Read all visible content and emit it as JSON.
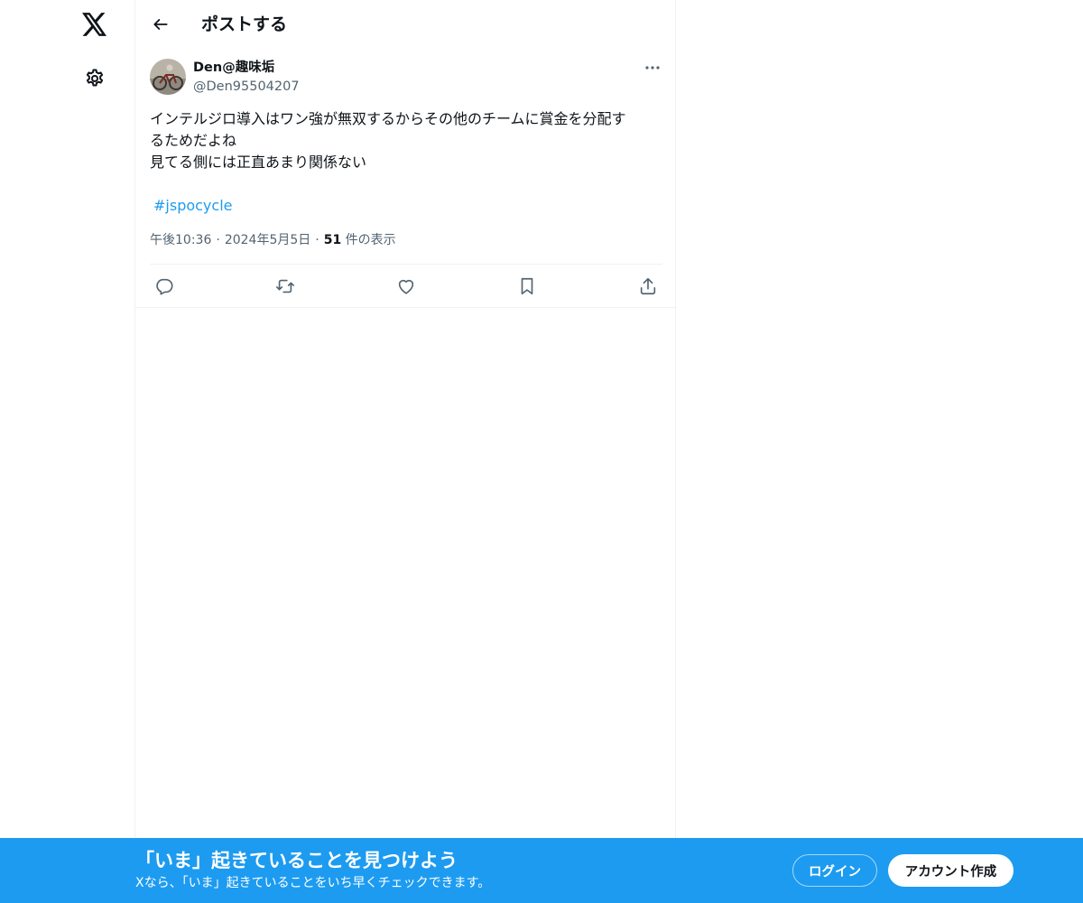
{
  "nav": {
    "logo_icon": "x-logo-icon",
    "settings_icon": "gear-icon"
  },
  "header": {
    "title": "ポストする",
    "back_icon": "arrow-left-icon"
  },
  "post": {
    "author": {
      "display_name": "Den@趣味垢",
      "handle": "@Den95504207"
    },
    "text_lines": [
      "インテルジロ導入はワン強が無双するからその他のチームに賞金を分配す",
      "るためだよね",
      "見てる側には正直あまり関係ない"
    ],
    "hashtag": "#jspocycle",
    "meta": {
      "time": "午後10:36",
      "date": "2024年5月5日",
      "separator": "·",
      "views_count": "51",
      "views_label": " 件の表示"
    },
    "actions": [
      {
        "name": "reply",
        "icon": "reply-icon"
      },
      {
        "name": "repost",
        "icon": "repost-icon"
      },
      {
        "name": "like",
        "icon": "heart-icon"
      },
      {
        "name": "bookmark",
        "icon": "bookmark-icon"
      },
      {
        "name": "share",
        "icon": "share-icon"
      }
    ]
  },
  "banner": {
    "title": "「いま」起きていることを見つけよう",
    "subtitle": "Xなら、「いま」起きていることをいち早くチェックできます。",
    "login_label": "ログイン",
    "signup_label": "アカウント作成"
  },
  "colors": {
    "accent": "#1d9bf0",
    "text": "#0f1419",
    "secondary_text": "#536471",
    "border": "#eff3f4"
  }
}
